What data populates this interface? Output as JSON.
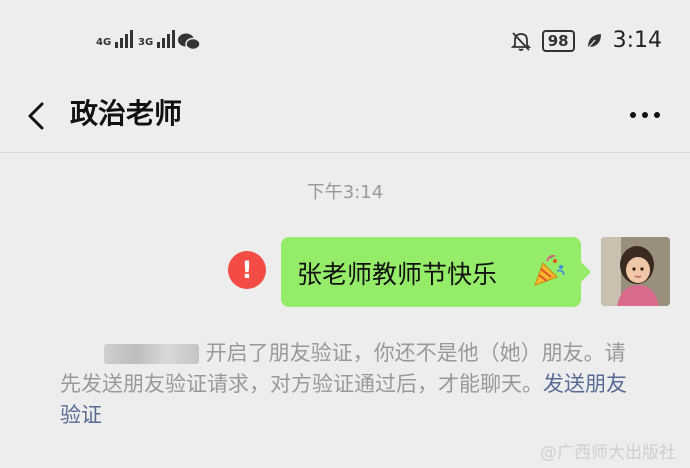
{
  "status_bar": {
    "network_1": "4G",
    "network_2": "3G",
    "battery": "98",
    "time": "3:14"
  },
  "nav": {
    "title": "政治老师"
  },
  "chat": {
    "timestamp": "下午3:14",
    "message": "张老师教师节快乐",
    "message_status": "failed",
    "error_glyph": "!",
    "system_notice_prefix": "开启了朋友验证，你还不是他（她）朋友。请先发送朋友验证请求，对方验证通过后，才能聊天。",
    "system_notice_link": "发送朋友验证"
  },
  "watermark": "@广西师大出版社",
  "colors": {
    "background": "#ededed",
    "bubble": "#95ec69",
    "error": "#f24c45",
    "link": "#576b95"
  },
  "icons": [
    "signal-icon",
    "wechat-icon",
    "mute-bell-icon",
    "battery-icon",
    "leaf-icon",
    "back-icon",
    "more-icon",
    "error-icon",
    "party-popper-icon",
    "avatar"
  ]
}
